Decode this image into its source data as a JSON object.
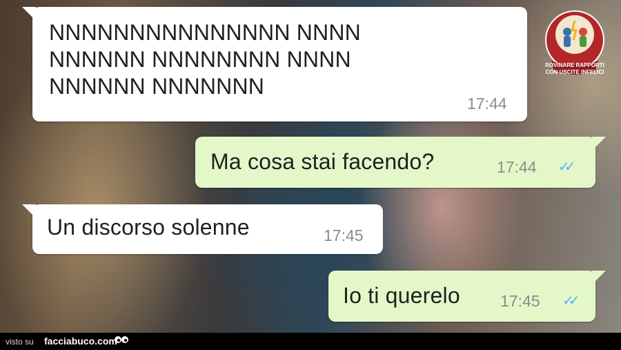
{
  "messages": [
    {
      "direction": "incoming",
      "text": "NNNNNNNNNNNNNNN NNNN\nNNNNNN NNNNNNNN NNNN\nNNNNNN NNNNNNN",
      "time": "17:44"
    },
    {
      "direction": "outgoing",
      "text": "Ma cosa stai facendo?",
      "time": "17:44",
      "ticks": "✓✓"
    },
    {
      "direction": "incoming",
      "text": "Un discorso solenne",
      "time": "17:45"
    },
    {
      "direction": "outgoing",
      "text": "Io ti querelo",
      "time": "17:45",
      "ticks": "✓✓"
    }
  ],
  "logo": {
    "line1": "ROVINARE RAPPORTI",
    "line2": "CON USCITE INFELICI"
  },
  "footer": {
    "visto_label": "visto su",
    "site": "facciabuco.com"
  },
  "colors": {
    "incoming_bubble": "#ffffff",
    "outgoing_bubble": "#e4f7c9",
    "read_ticks": "#4fb6ec",
    "footer_bg": "#000000"
  }
}
